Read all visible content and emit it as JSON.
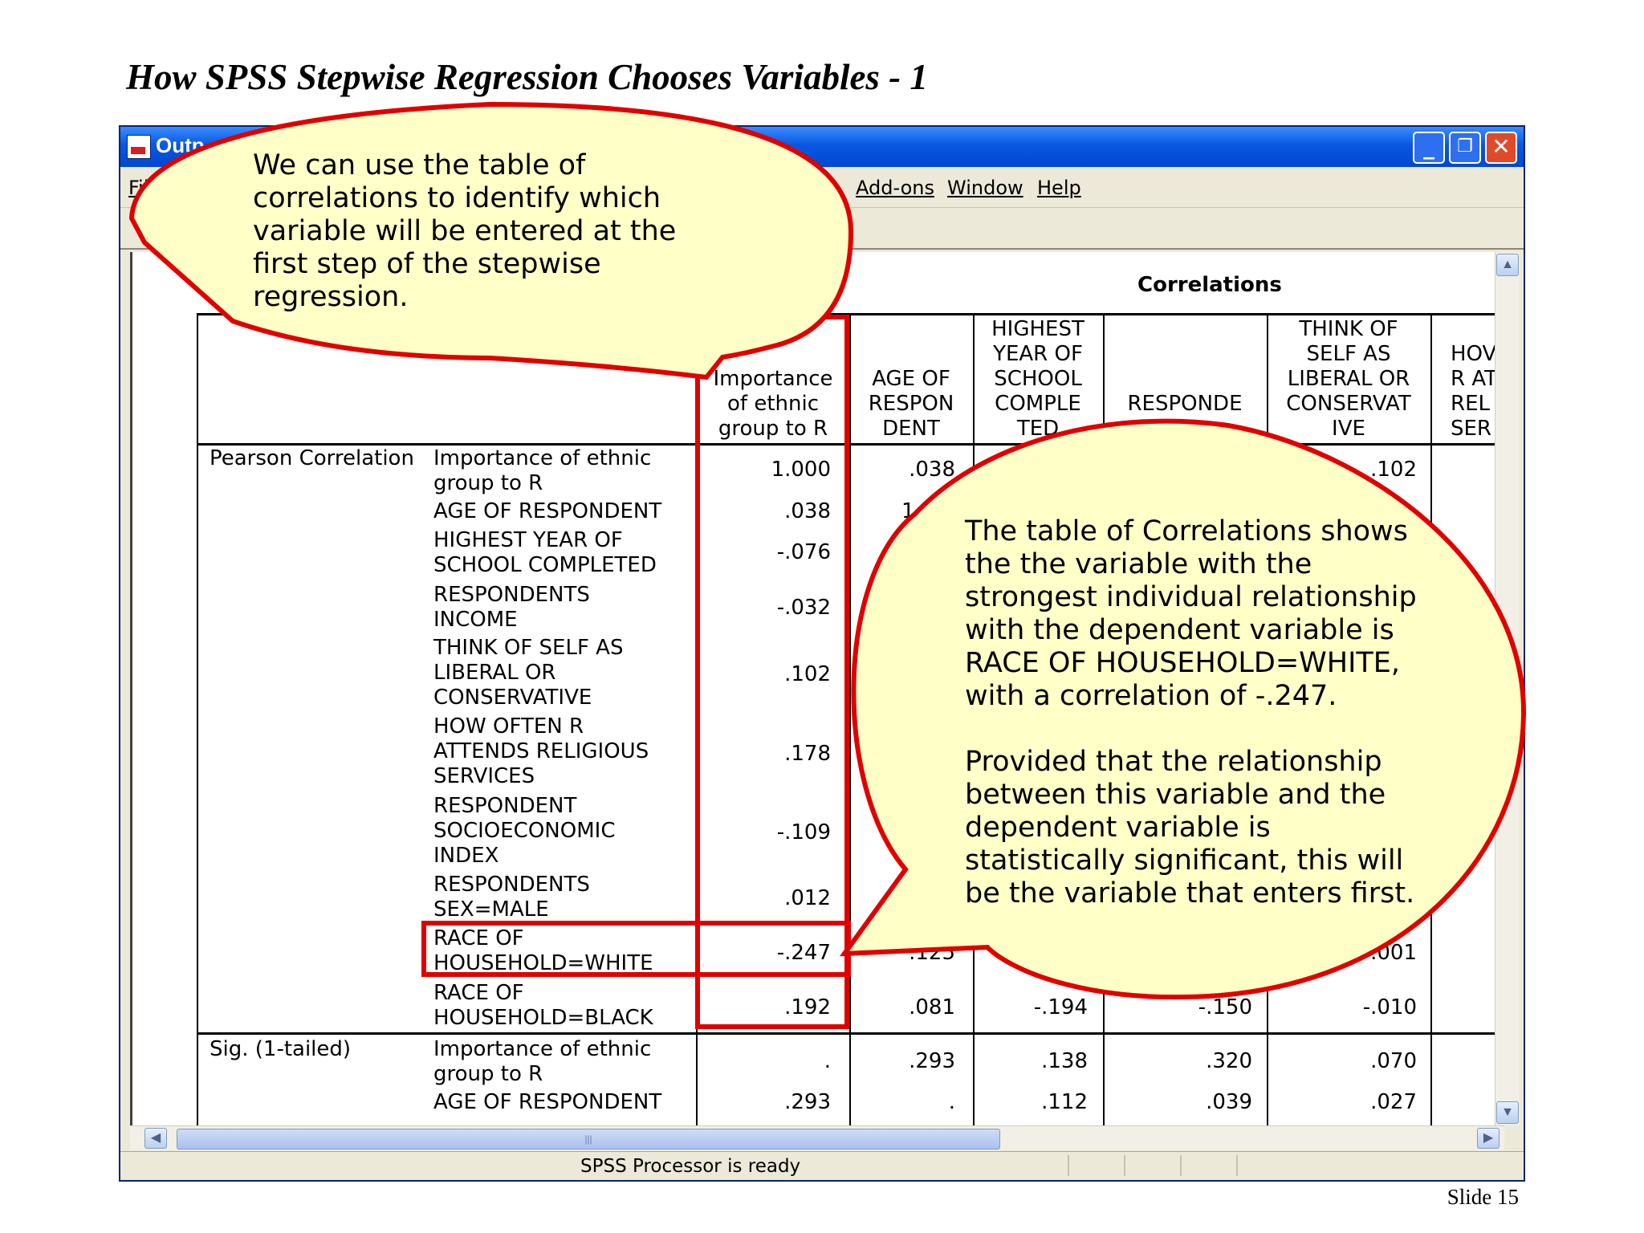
{
  "slide": {
    "title": "How SPSS Stepwise Regression Chooses Variables - 1",
    "footer": "Slide 15"
  },
  "window": {
    "title": "Outp",
    "buttons": {
      "minimize": "_",
      "maximize": "❐",
      "close": "✕"
    }
  },
  "menu": {
    "items": [
      "Fil",
      "Add-ons",
      "Window",
      "Help"
    ]
  },
  "table": {
    "title": "Correlations",
    "column_headers": [
      [
        "Importance",
        "of ethnic",
        "group to R"
      ],
      [
        "AGE OF",
        "RESPON",
        "DENT"
      ],
      [
        "HIGHEST",
        "YEAR OF",
        "SCHOOL",
        "COMPLE",
        "TED"
      ],
      [
        "RESPONDE"
      ],
      [
        "THINK OF",
        "SELF AS",
        "LIBERAL OR",
        "CONSERVAT",
        "IVE"
      ],
      [
        "HOV",
        "R AT",
        "REL",
        "SER"
      ]
    ],
    "group_labels": [
      "Pearson Correlation",
      "Sig. (1-tailed)"
    ],
    "row_labels": [
      [
        "Importance of ethnic",
        "group to R"
      ],
      [
        "AGE OF RESPONDENT"
      ],
      [
        "HIGHEST YEAR OF",
        "SCHOOL COMPLETED"
      ],
      [
        "RESPONDENTS",
        "INCOME"
      ],
      [
        "THINK OF SELF AS",
        "LIBERAL OR",
        "CONSERVATIVE"
      ],
      [
        "HOW OFTEN R",
        "ATTENDS RELIGIOUS",
        "SERVICES"
      ],
      [
        "RESPONDENT",
        "SOCIOECONOMIC",
        "INDEX"
      ],
      [
        "RESPONDENTS",
        "SEX=MALE"
      ],
      [
        "RACE OF",
        "HOUSEHOLD=WHITE"
      ],
      [
        "RACE OF",
        "HOUSEHOLD=BLACK"
      ],
      [
        "Importance of ethnic",
        "group to R"
      ],
      [
        "AGE OF RESPONDENT"
      ]
    ],
    "cells": {
      "r0": [
        "1.000",
        ".038",
        ".102"
      ],
      "r1": [
        ".038",
        "1.00"
      ],
      "r2": [
        "-.076"
      ],
      "r3": [
        "-.032"
      ],
      "r4": [
        ".102"
      ],
      "r5": [
        ".178"
      ],
      "r6": [
        "-.109"
      ],
      "r7": [
        ".012"
      ],
      "r8": [
        "-.247",
        ".125",
        ".001"
      ],
      "r9": [
        ".192",
        ".081",
        "-.194",
        "-.150",
        "-.010"
      ],
      "r10": [
        ".",
        ".293",
        ".138",
        ".320",
        ".070"
      ],
      "r11": [
        ".293",
        ".",
        ".112",
        ".039",
        ".027"
      ]
    }
  },
  "callouts": {
    "top": [
      "We can use the table of",
      "correlations to identify which",
      "variable will be entered at the",
      "first step of the stepwise",
      "regression."
    ],
    "right_p1": [
      "The table of Correlations shows",
      "the the variable with the",
      "strongest individual relationship",
      "with the dependent variable is",
      "RACE OF HOUSEHOLD=WHITE,",
      "with a correlation of -.247."
    ],
    "right_p2": [
      "Provided that the relationship",
      "between this variable and the",
      "dependent variable is",
      "statistically significant, this will",
      "be the variable that enters first."
    ]
  },
  "status": {
    "text": "SPSS Processor is ready"
  },
  "colors": {
    "callout_fill": "#ffffc8",
    "callout_border": "#e00000",
    "titlebar": "#0a58e0"
  }
}
